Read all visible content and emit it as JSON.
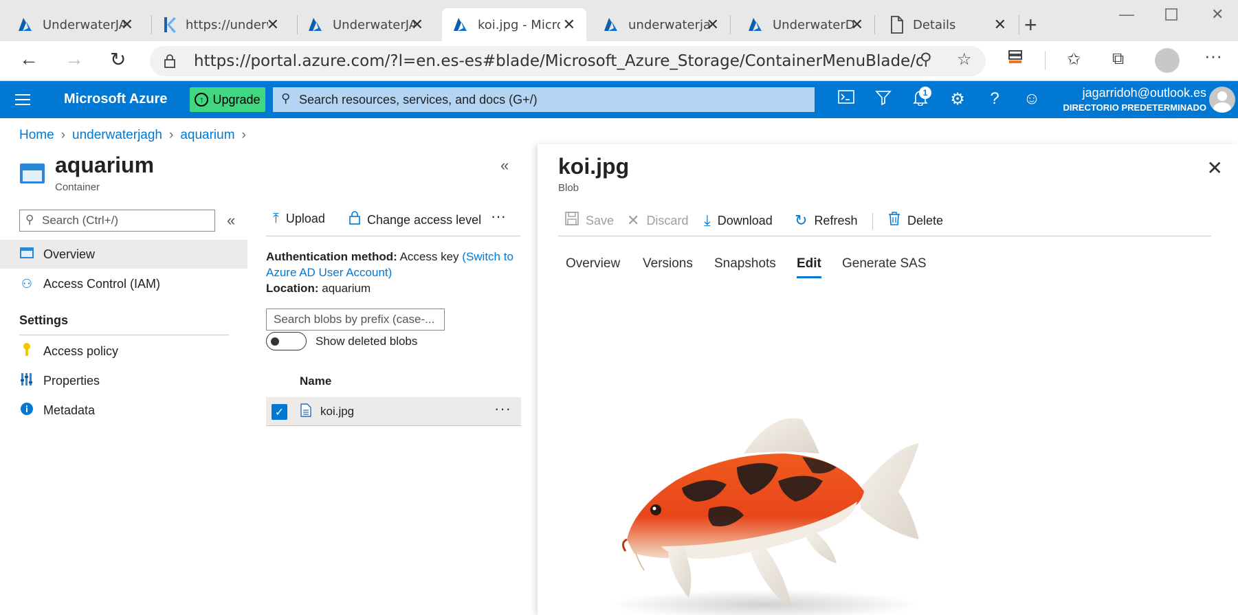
{
  "browser": {
    "tabs": [
      {
        "title": "UnderwaterJAGH",
        "icon": "azure-icon"
      },
      {
        "title": "https://underwaterjagh",
        "icon": "k-icon"
      },
      {
        "title": "UnderwaterJAGH",
        "icon": "azure-icon"
      },
      {
        "title": "koi.jpg - Microsoft Azure",
        "icon": "azure-icon",
        "active": true
      },
      {
        "title": "underwaterjagh",
        "icon": "azure-icon"
      },
      {
        "title": "UnderwaterDB",
        "icon": "azure-icon"
      },
      {
        "title": "Details",
        "icon": "page-icon"
      }
    ],
    "url": "https://portal.azure.com/?l=en.es-es#blade/Microsoft_Azure_Storage/ContainerMenuBlade/ove..."
  },
  "azure": {
    "brand": "Microsoft Azure",
    "upgrade": "Upgrade",
    "search_placeholder": "Search resources, services, and docs (G+/)",
    "notification_count": "1",
    "account_email": "jagarridoh@outlook.es",
    "account_directory": "DIRECTORIO PREDETERMINADO"
  },
  "breadcrumb": [
    "Home",
    "underwaterjagh",
    "aquarium"
  ],
  "container": {
    "title": "aquarium",
    "subtitle": "Container",
    "search_placeholder": "Search (Ctrl+/)",
    "menu": {
      "overview": "Overview",
      "iam": "Access Control (IAM)",
      "settings": "Settings",
      "access_policy": "Access policy",
      "properties": "Properties",
      "metadata": "Metadata"
    },
    "commands": {
      "upload": "Upload",
      "change_access": "Change access level",
      "more": "···"
    },
    "auth_label": "Authentication method:",
    "auth_value": "Access key",
    "auth_switch": "(Switch to Azure AD User Account)",
    "location_label": "Location:",
    "location_value": "aquarium",
    "blob_search_placeholder": "Search blobs by prefix (case-...",
    "show_deleted": "Show deleted blobs",
    "column_name": "Name",
    "blobs": [
      {
        "name": "koi.jpg"
      }
    ]
  },
  "blob": {
    "title": "koi.jpg",
    "subtitle": "Blob",
    "commands": {
      "save": "Save",
      "discard": "Discard",
      "download": "Download",
      "refresh": "Refresh",
      "delete": "Delete"
    },
    "tabs": {
      "overview": "Overview",
      "versions": "Versions",
      "snapshots": "Snapshots",
      "edit": "Edit",
      "generate_sas": "Generate SAS"
    },
    "active_tab": "Edit"
  }
}
